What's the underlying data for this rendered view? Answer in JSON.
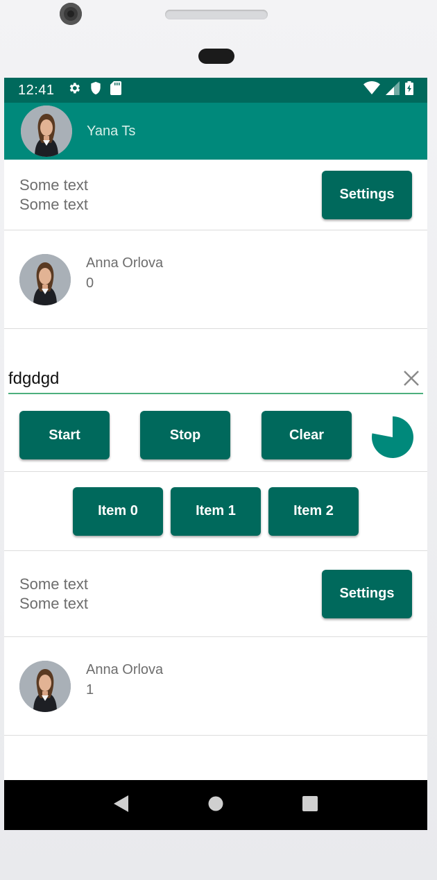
{
  "status_bar": {
    "time": "12:41",
    "left_icons": [
      "gear-icon",
      "shield-icon",
      "sd-card-icon"
    ],
    "right_icons": [
      "wifi-icon",
      "signal-icon",
      "battery-icon"
    ]
  },
  "app_bar": {
    "title": "Yana Ts",
    "color": "#00897b"
  },
  "rows": {
    "text1": {
      "line1": "Some text",
      "line2": "Some text",
      "button": "Settings"
    },
    "person1": {
      "name": "Anna Orlova",
      "value": "0"
    },
    "input": {
      "value": "fdgdgd"
    },
    "controls": {
      "start": "Start",
      "stop": "Stop",
      "clear": "Clear",
      "progress": 0.78
    },
    "items": [
      "Item 0",
      "Item 1",
      "Item 2"
    ],
    "text2": {
      "line1": "Some text",
      "line2": "Some text",
      "button": "Settings"
    },
    "person2": {
      "name": "Anna Orlova",
      "value": "1"
    }
  },
  "nav_bar": {
    "icons": [
      "back-icon",
      "home-icon",
      "recents-icon"
    ]
  },
  "colors": {
    "primary_dark": "#00695c",
    "primary": "#00897b",
    "accent": "#4caf7d"
  }
}
